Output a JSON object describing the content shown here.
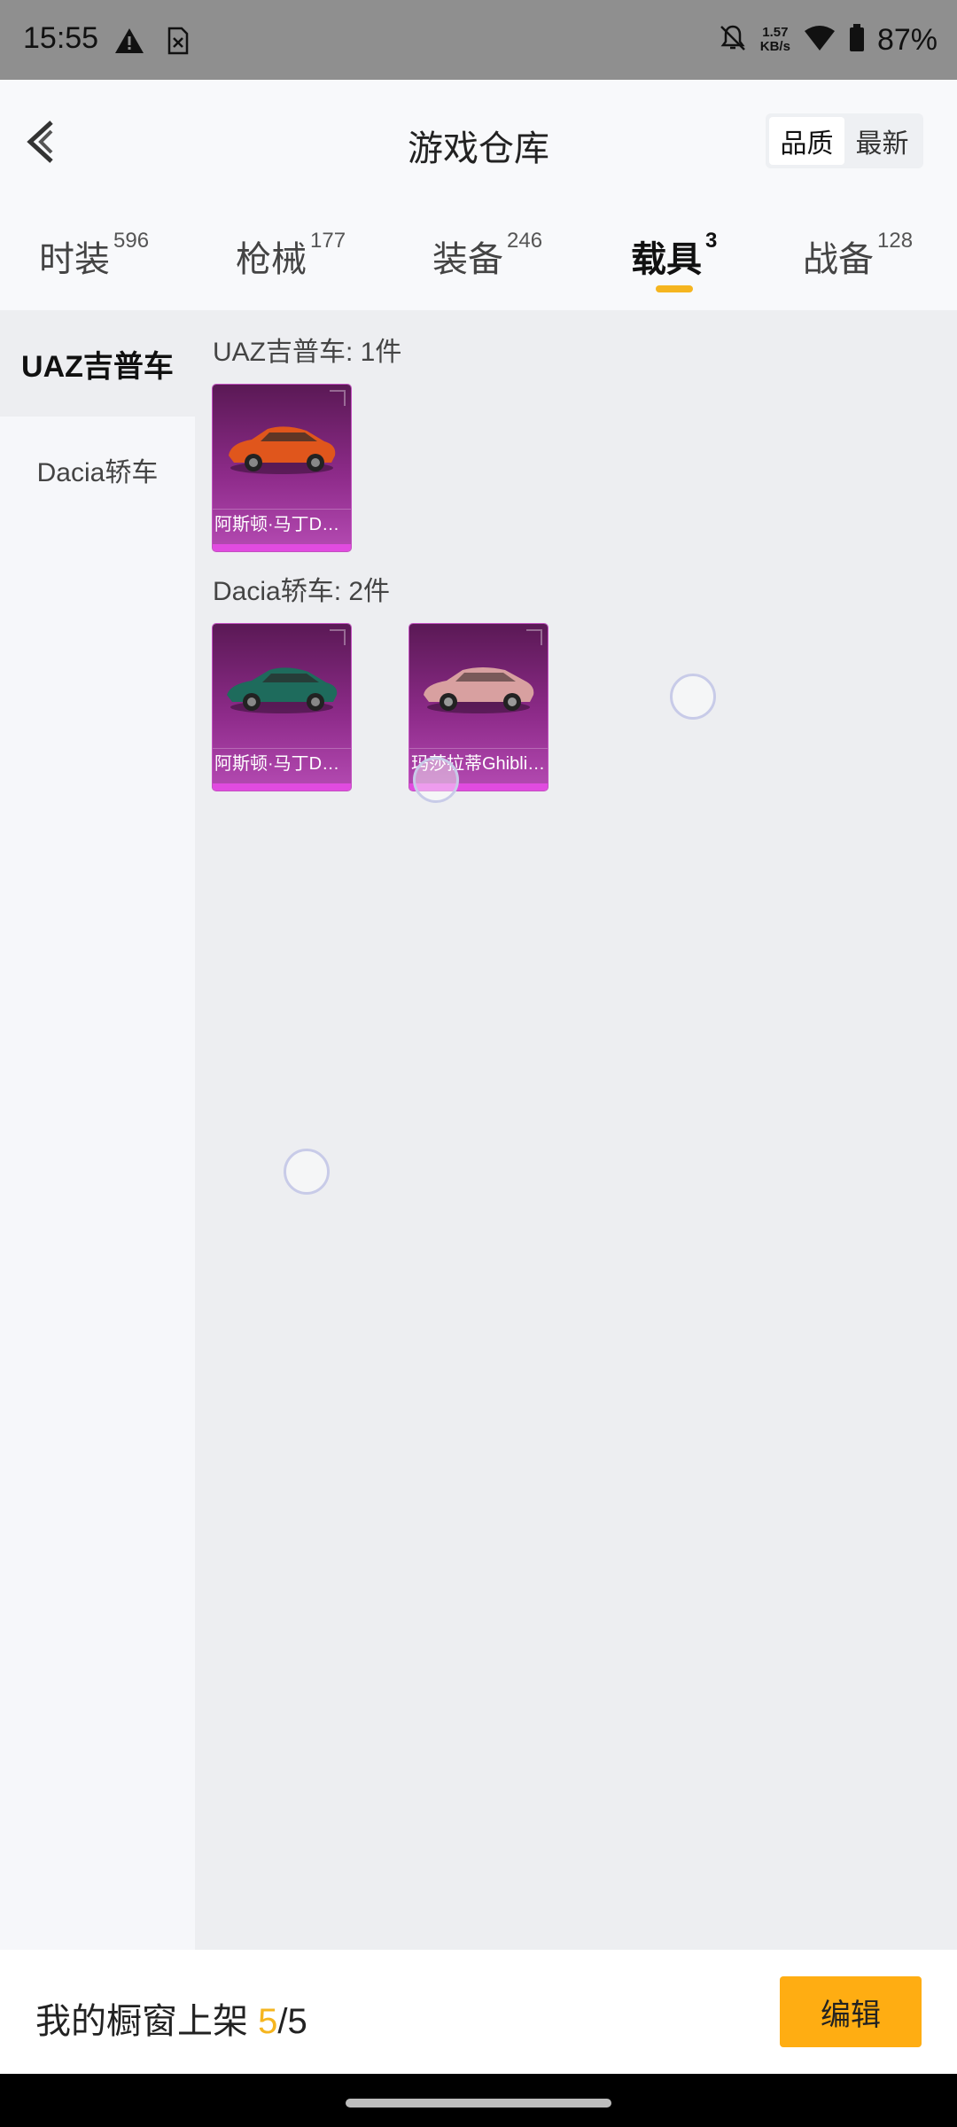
{
  "status_bar": {
    "time": "15:55",
    "net_speed_value": "1.57",
    "net_speed_unit": "KB/s",
    "battery_percent": "87%"
  },
  "header": {
    "title": "游戏仓库",
    "sort_options": [
      "品质",
      "最新"
    ],
    "active_sort": "品质"
  },
  "tabs": [
    {
      "label": "时装",
      "count": "596"
    },
    {
      "label": "枪械",
      "count": "177"
    },
    {
      "label": "装备",
      "count": "246"
    },
    {
      "label": "载具",
      "count": "3"
    },
    {
      "label": "战备",
      "count": "128"
    }
  ],
  "active_tab": "载具",
  "sidebar": {
    "items": [
      "UAZ吉普车",
      "Dacia轿车"
    ],
    "active": "UAZ吉普车"
  },
  "sections": [
    {
      "title": "UAZ吉普车: 1件",
      "items": [
        {
          "label": "阿斯顿·马丁DB…",
          "car_color": "#e0561c"
        }
      ]
    },
    {
      "title": "Dacia轿车: 2件",
      "items": [
        {
          "label": "阿斯顿·马丁DB…",
          "car_color": "#1e6b5c"
        },
        {
          "label": "玛莎拉蒂Ghibli(…",
          "car_color": "#d8a0a0"
        }
      ]
    }
  ],
  "bottom_bar": {
    "showcase_prefix": "我的橱窗上架 ",
    "showcase_current": "5",
    "showcase_total": "/5",
    "edit_label": "编辑"
  },
  "colors": {
    "accent": "#f5b51f",
    "edit_button": "#ffad12",
    "card_purple": "#8e2b8a"
  }
}
